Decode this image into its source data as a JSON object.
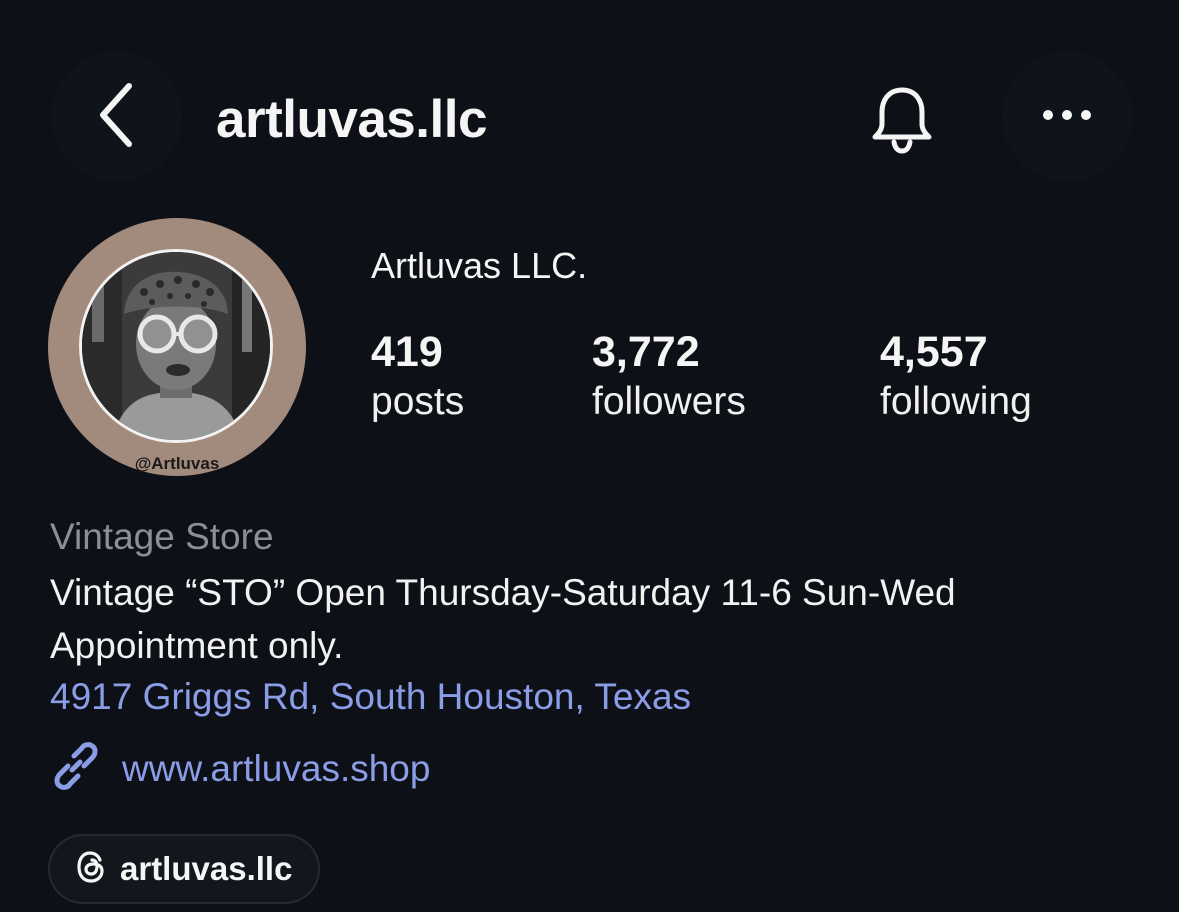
{
  "header": {
    "username": "artluvas.llc",
    "back_icon": "chevron-left-icon",
    "bell_icon": "bell-icon",
    "more_icon": "ellipsis-icon"
  },
  "avatar": {
    "watermark": "@Artluvas",
    "ring_color": "#a28a7c"
  },
  "profile": {
    "display_name": "Artluvas LLC."
  },
  "stats": {
    "posts": {
      "value": "419",
      "label": "posts"
    },
    "followers": {
      "value": "3,772",
      "label": "followers"
    },
    "following": {
      "value": "4,557",
      "label": "following"
    }
  },
  "bio": {
    "category": "Vintage Store",
    "text": "Vintage “STO” Open Thursday-Saturday 11-6 Sun-Wed Appointment only.",
    "address": "4917 Griggs Rd, South Houston, Texas",
    "website": "www.artluvas.shop",
    "link_icon": "link-icon"
  },
  "threads": {
    "label": "artluvas.llc",
    "icon": "threads-icon"
  },
  "colors": {
    "background": "#0d1117",
    "link": "#8b9de6",
    "muted": "#8b8f96"
  }
}
